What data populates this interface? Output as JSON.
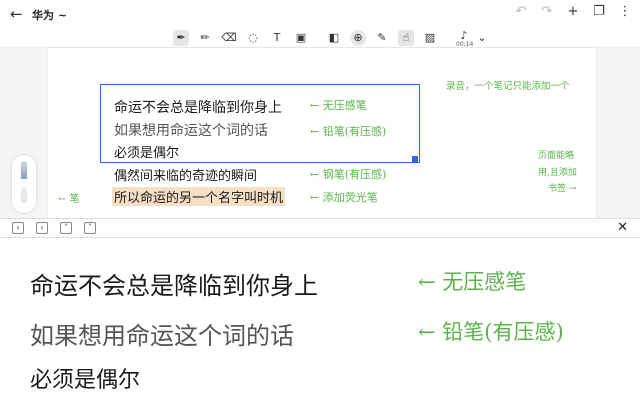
{
  "header": {
    "back_icon": "back-arrow-icon",
    "title": "华为 ~"
  },
  "top_actions": [
    "undo-icon",
    "redo-icon",
    "add-icon",
    "copy-icon",
    "more-icon"
  ],
  "toolbar": {
    "mic_time": "00:14"
  },
  "note": {
    "lines": [
      "命运不会总是降临到你身上",
      "如果想用命运这个词的话",
      "必须是偶尔",
      "偶然间来临的奇迹的瞬间",
      "所以命运的另一个名字叫时机"
    ],
    "labels": [
      "← 无压感笔",
      "← 铅笔(有压感)",
      "← 钢笔(有压感)",
      "← 添加荧光笔"
    ],
    "top_right": "录音，一个笔记只能添加一个",
    "side_note": [
      "页面能略",
      "用,且添加",
      "书签 →"
    ],
    "left_note": "← 笔"
  },
  "zoom": {
    "lines": [
      "命运不会总是降临到你身上",
      "如果想用命运这个词的话",
      "必须是偶尔"
    ],
    "labels": [
      "← 无压感笔",
      "← 铅笔(有压感)"
    ]
  }
}
